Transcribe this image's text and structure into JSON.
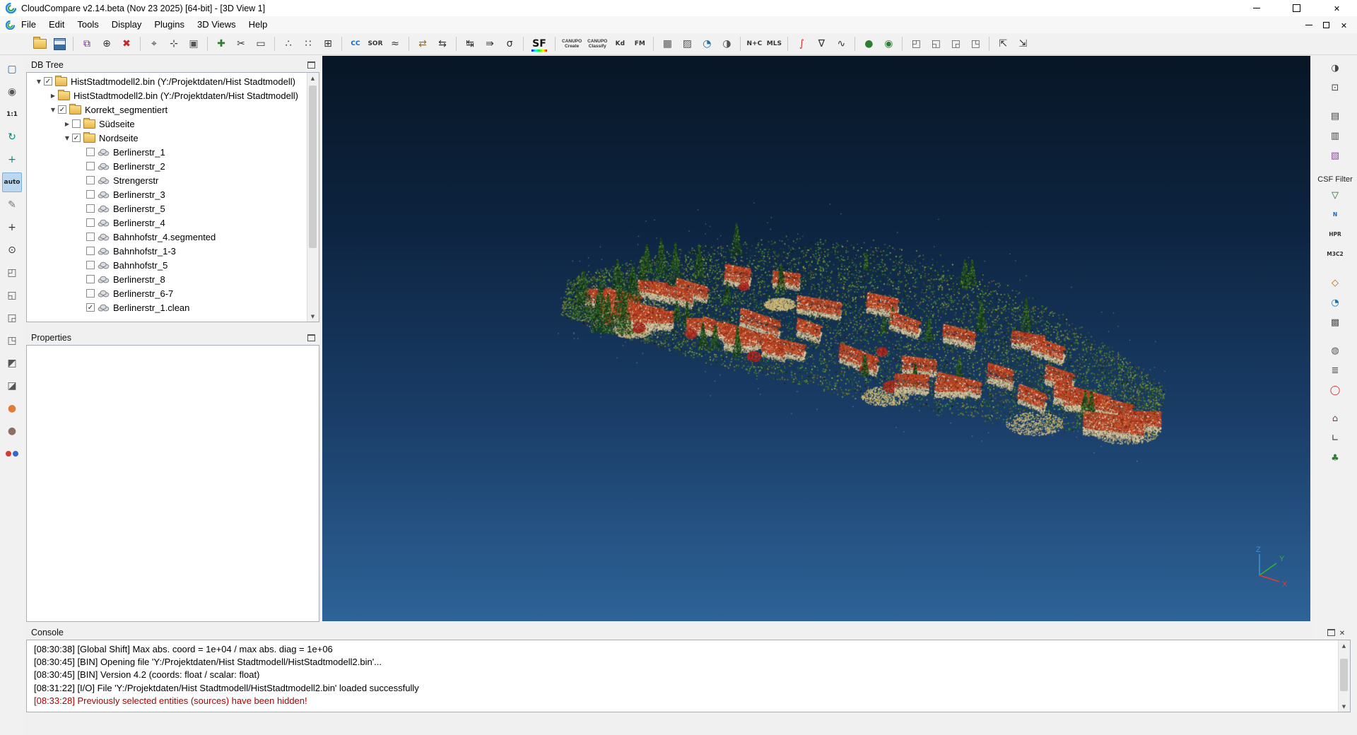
{
  "window": {
    "title": "CloudCompare v2.14.beta (Nov 23 2025) [64-bit] - [3D View 1]"
  },
  "menu": {
    "items": [
      "File",
      "Edit",
      "Tools",
      "Display",
      "Plugins",
      "3D Views",
      "Help"
    ]
  },
  "toolbar": {
    "items": [
      {
        "name": "open",
        "shape": "folder"
      },
      {
        "name": "save",
        "shape": "floppy"
      },
      {
        "sep": true
      },
      {
        "name": "clone",
        "glyph": "⧉",
        "color": "#7b1fa2"
      },
      {
        "name": "merge",
        "glyph": "⊕",
        "color": "#333333"
      },
      {
        "name": "delete",
        "glyph": "✖",
        "color": "#c62828"
      },
      {
        "sep": true
      },
      {
        "name": "point-picking",
        "glyph": "⌖",
        "color": "#333333"
      },
      {
        "name": "point-list-picking",
        "glyph": "⊹",
        "color": "#333333"
      },
      {
        "name": "clipping-box",
        "glyph": "▣",
        "color": "#555555"
      },
      {
        "sep": true
      },
      {
        "name": "translate-rotate",
        "glyph": "✚",
        "color": "#2e7d32"
      },
      {
        "name": "segment",
        "glyph": "✂",
        "color": "#333333"
      },
      {
        "name": "crop",
        "glyph": "▭",
        "color": "#333333"
      },
      {
        "sep": true
      },
      {
        "name": "sample-points",
        "glyph": "∴",
        "color": "#333333"
      },
      {
        "name": "subsample",
        "glyph": "∷",
        "color": "#333333"
      },
      {
        "name": "octree",
        "glyph": "⊞",
        "color": "#333333"
      },
      {
        "sep": true
      },
      {
        "name": "cc-plugin",
        "text": "CC",
        "color": "#1565c0"
      },
      {
        "name": "sor-filter",
        "text": "SOR",
        "color": "#333333"
      },
      {
        "name": "noise-filter",
        "glyph": "≈",
        "color": "#333333"
      },
      {
        "sep": true
      },
      {
        "name": "register",
        "glyph": "⇄",
        "color": "#b26a00"
      },
      {
        "name": "align",
        "glyph": "⇆",
        "color": "#333333"
      },
      {
        "sep": true
      },
      {
        "name": "cloud-cloud-distance",
        "glyph": "↹",
        "color": "#333333"
      },
      {
        "name": "cloud-mesh-distance",
        "glyph": "⇛",
        "color": "#333333"
      },
      {
        "name": "statistical-test",
        "glyph": "σ",
        "color": "#333333"
      },
      {
        "sep": true
      },
      {
        "name": "filter-by-sf",
        "text": "SF",
        "cls": "sf"
      },
      {
        "sep": true
      },
      {
        "name": "canupo-create",
        "lines": [
          "CANUPO",
          "Create"
        ]
      },
      {
        "name": "canupo-classify",
        "lines": [
          "CANUPO",
          "Classify"
        ]
      },
      {
        "name": "kd-tree",
        "text": "Kd",
        "color": "#333333"
      },
      {
        "name": "fm",
        "text": "FM",
        "color": "#333333"
      },
      {
        "sep": true
      },
      {
        "name": "mesh",
        "glyph": "▦",
        "color": "#555555"
      },
      {
        "name": "texture",
        "glyph": "▨",
        "color": "#555555"
      },
      {
        "name": "globe",
        "glyph": "◔",
        "color": "#1b6fae"
      },
      {
        "name": "sphere",
        "glyph": "◑",
        "color": "#555555"
      },
      {
        "sep": true
      },
      {
        "name": "normals-compute",
        "text": "N+C",
        "color": "#333333"
      },
      {
        "name": "mls",
        "text": "MLS",
        "color": "#333333"
      },
      {
        "sep": true
      },
      {
        "name": "curvature",
        "glyph": "∫",
        "color": "#d32f2f"
      },
      {
        "name": "gradient",
        "glyph": "∇",
        "color": "#333333"
      },
      {
        "name": "roughness",
        "glyph": "∿",
        "color": "#333333"
      },
      {
        "sep": true
      },
      {
        "name": "validate-green",
        "glyph": "●",
        "color": "#2e7d32"
      },
      {
        "name": "validate-green-2",
        "glyph": "◉",
        "color": "#2e7d32"
      },
      {
        "sep": true
      },
      {
        "name": "box-top-view",
        "glyph": "◰",
        "color": "#555555"
      },
      {
        "name": "box-bottom-view",
        "glyph": "◱",
        "color": "#555555"
      },
      {
        "name": "box-front-view",
        "glyph": "◲",
        "color": "#555555"
      },
      {
        "name": "box-back-view",
        "glyph": "◳",
        "color": "#555555"
      },
      {
        "sep": true
      },
      {
        "name": "fit-page",
        "glyph": "⇱",
        "color": "#333333"
      },
      {
        "name": "fit-width",
        "glyph": "⇲",
        "color": "#333333"
      }
    ]
  },
  "left_toolbar": {
    "items": [
      {
        "name": "display-options",
        "glyph": "▢",
        "color": "#1565c0"
      },
      {
        "name": "screenshot-camera",
        "glyph": "◉",
        "color": "#555555"
      },
      {
        "name": "zoom-1-1",
        "text": "1:1",
        "color": "#222222"
      },
      {
        "name": "orbit-rotate",
        "glyph": "↻",
        "color": "#00897b"
      },
      {
        "name": "pivot-center",
        "glyph": "+",
        "color": "#00897b"
      },
      {
        "name": "auto-pivot",
        "text": "auto",
        "color": "#222222",
        "active": true
      },
      {
        "name": "edit-pencil",
        "glyph": "✎",
        "color": "#777777"
      },
      {
        "name": "pick-rotation-center",
        "glyph": "+",
        "color": "#333333"
      },
      {
        "name": "zoom-magnifier",
        "glyph": "⊙",
        "color": "#333333"
      },
      {
        "name": "view-top",
        "glyph": "◰",
        "color": "#555555"
      },
      {
        "name": "view-bottom",
        "glyph": "◱",
        "color": "#555555"
      },
      {
        "name": "view-front",
        "glyph": "◲",
        "color": "#555555"
      },
      {
        "name": "view-back",
        "glyph": "◳",
        "color": "#555555"
      },
      {
        "name": "view-left",
        "glyph": "◩",
        "color": "#555555"
      },
      {
        "name": "view-right",
        "glyph": "◪",
        "color": "#555555"
      },
      {
        "name": "view-front-sphere",
        "glyph": "●",
        "color": "#e07b39"
      },
      {
        "name": "view-back-sphere",
        "glyph": "●",
        "color": "#8d6e63"
      },
      {
        "name": "stereo-mode",
        "stereo": true
      }
    ]
  },
  "right_toolbar": {
    "items": [
      {
        "name": "pcv-render",
        "glyph": "◑",
        "color": "#444444"
      },
      {
        "name": "screenshot-plugin",
        "glyph": "⊡",
        "color": "#444444"
      },
      {
        "name": "animation",
        "glyph": "▤",
        "color": "#444444",
        "gap": true
      },
      {
        "name": "render-film",
        "glyph": "▥",
        "color": "#444444"
      },
      {
        "name": "color-scale",
        "glyph": "▧",
        "color": "#8e4b9e"
      },
      {
        "name": "csf-filter-label",
        "label": "CSF Filter",
        "gap": true
      },
      {
        "name": "csf-filter",
        "glyph": "▽",
        "color": "#2e5d32"
      },
      {
        "name": "compass",
        "text": "N",
        "color": "#1565c0"
      },
      {
        "name": "hpr",
        "text": "HPR",
        "color": "#333333"
      },
      {
        "name": "m3c2",
        "text": "M3C2",
        "color": "#333333"
      },
      {
        "name": "facets",
        "glyph": "◇",
        "color": "#b26a00",
        "gap": true
      },
      {
        "name": "geo-globe",
        "glyph": "◔",
        "color": "#1b6fae"
      },
      {
        "name": "ransac",
        "glyph": "▩",
        "color": "#555555"
      },
      {
        "name": "poisson-recon",
        "glyph": "◍",
        "color": "#555555",
        "gap": true
      },
      {
        "name": "layers",
        "glyph": "≣",
        "color": "#555555"
      },
      {
        "name": "ellipse-fit",
        "glyph": "◯",
        "color": "#c62828"
      },
      {
        "name": "footprints",
        "glyph": "⌂",
        "color": "#6d4c41",
        "gap": true
      },
      {
        "name": "measure",
        "glyph": "∟",
        "color": "#333333"
      },
      {
        "name": "vegetation",
        "glyph": "♣",
        "color": "#2e7d32"
      }
    ]
  },
  "db_tree": {
    "title": "DB Tree",
    "items": [
      {
        "label": "HistStadtmodell2.bin (Y:/Projektdaten/Hist Stadtmodell)",
        "indent": 0,
        "expander": "open",
        "checkbox": "checked",
        "icon": "folder"
      },
      {
        "label": "HistStadtmodell2.bin (Y:/Projektdaten/Hist Stadtmodell)",
        "indent": 1,
        "expander": "closed",
        "checkbox": "none",
        "icon": "folder"
      },
      {
        "label": "Korrekt_segmentiert",
        "indent": 1,
        "expander": "open",
        "checkbox": "checked",
        "icon": "folder"
      },
      {
        "label": "Südseite",
        "indent": 2,
        "expander": "closed",
        "checkbox": "unchecked",
        "icon": "folder"
      },
      {
        "label": "Nordseite",
        "indent": 2,
        "expander": "open",
        "checkbox": "checked",
        "icon": "folder"
      },
      {
        "label": "Berlinerstr_1",
        "indent": 3,
        "expander": "none",
        "checkbox": "unchecked",
        "icon": "cloud"
      },
      {
        "label": "Berlinerstr_2",
        "indent": 3,
        "expander": "none",
        "checkbox": "unchecked",
        "icon": "cloud"
      },
      {
        "label": "Strengerstr",
        "indent": 3,
        "expander": "none",
        "checkbox": "unchecked",
        "icon": "cloud"
      },
      {
        "label": "Berlinerstr_3",
        "indent": 3,
        "expander": "none",
        "checkbox": "unchecked",
        "icon": "cloud"
      },
      {
        "label": "Berlinerstr_5",
        "indent": 3,
        "expander": "none",
        "checkbox": "unchecked",
        "icon": "cloud"
      },
      {
        "label": "Berlinerstr_4",
        "indent": 3,
        "expander": "none",
        "checkbox": "unchecked",
        "icon": "cloud"
      },
      {
        "label": "Bahnhofstr_4.segmented",
        "indent": 3,
        "expander": "none",
        "checkbox": "unchecked",
        "icon": "cloud"
      },
      {
        "label": "Bahnhofstr_1-3",
        "indent": 3,
        "expander": "none",
        "checkbox": "unchecked",
        "icon": "cloud"
      },
      {
        "label": "Bahnhofstr_5",
        "indent": 3,
        "expander": "none",
        "checkbox": "unchecked",
        "icon": "cloud"
      },
      {
        "label": "Berlinerstr_8",
        "indent": 3,
        "expander": "none",
        "checkbox": "unchecked",
        "icon": "cloud"
      },
      {
        "label": "Berlinerstr_6-7",
        "indent": 3,
        "expander": "none",
        "checkbox": "unchecked",
        "icon": "cloud"
      },
      {
        "label": "Berlinerstr_1.clean",
        "indent": 3,
        "expander": "none",
        "checkbox": "checked",
        "icon": "cloud"
      }
    ]
  },
  "properties_panel": {
    "title": "Properties"
  },
  "viewport": {
    "axes": {
      "x": "X",
      "y": "Y",
      "z": "Z"
    }
  },
  "console": {
    "title": "Console",
    "lines": [
      {
        "text": "[08:30:38] [Global Shift] Max abs. coord = 1e+04 / max abs. diag = 1e+06"
      },
      {
        "text": "[08:30:45] [BIN] Opening file 'Y:/Projektdaten/Hist Stadtmodell/HistStadtmodell2.bin'..."
      },
      {
        "text": "[08:30:45] [BIN] Version 4.2 (coords: float / scalar: float)"
      },
      {
        "text": "[08:31:22] [I/O] File 'Y:/Projektdaten/Hist Stadtmodell/HistStadtmodell2.bin' loaded successfully"
      },
      {
        "text": "[08:33:28] Previously selected entities (sources) have been hidden!",
        "error": true
      }
    ]
  }
}
